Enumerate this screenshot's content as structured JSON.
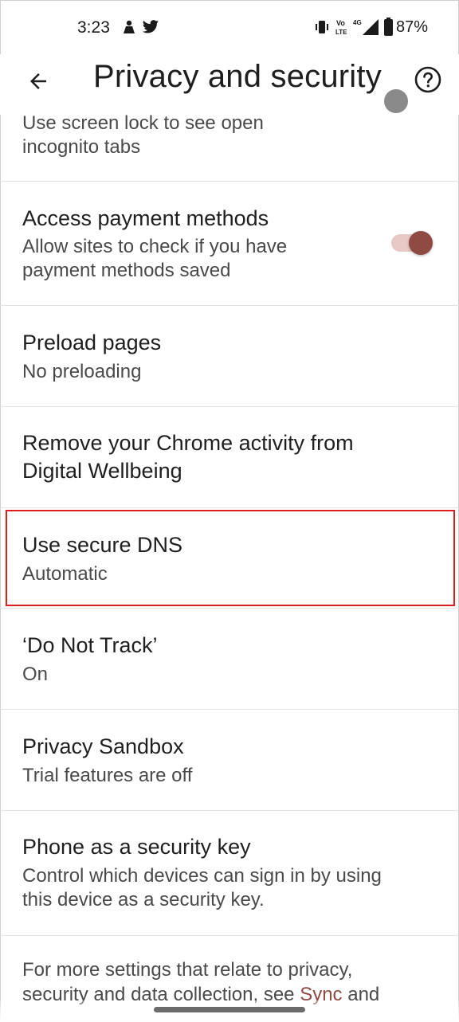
{
  "status_bar": {
    "time": "3:23",
    "battery": "87%",
    "icons": [
      "notification-icon",
      "twitter-icon",
      "vibrate-icon",
      "volte-icon",
      "signal-4g-icon",
      "battery-icon"
    ]
  },
  "header": {
    "title": "Privacy and security",
    "back_icon": "arrow-back-icon",
    "help_icon": "help-circle-icon"
  },
  "settings": {
    "incognito_lock": {
      "subtitle_line1": "Use screen lock to see open",
      "subtitle_line2": "incognito tabs"
    },
    "payment_methods": {
      "title": "Access payment methods",
      "subtitle_line1": "Allow sites to check if you have",
      "subtitle_line2": "payment methods saved",
      "toggle_on": true
    },
    "preload": {
      "title": "Preload pages",
      "subtitle": "No preloading"
    },
    "digital_wellbeing": {
      "title_line1": "Remove your Chrome activity from",
      "title_line2": "Digital Wellbeing"
    },
    "secure_dns": {
      "title": "Use secure DNS",
      "subtitle": "Automatic",
      "highlighted": true
    },
    "do_not_track": {
      "title": "‘Do Not Track’",
      "subtitle": "On"
    },
    "privacy_sandbox": {
      "title": "Privacy Sandbox",
      "subtitle": "Trial features are off"
    },
    "security_key": {
      "title": "Phone as a security key",
      "subtitle_line1": "Control which devices can sign in by using",
      "subtitle_line2": "this device as a security key."
    }
  },
  "footer": {
    "line1": "For more settings that relate to privacy,",
    "line2_prefix": "security and data collection, see ",
    "line2_link": "Sync",
    "line2_suffix": " and"
  },
  "colors": {
    "accent": "#8f4b43",
    "toggle_track": "#e8c9c5",
    "highlight": "#e01e1e",
    "divider": "#e3e3e3"
  }
}
